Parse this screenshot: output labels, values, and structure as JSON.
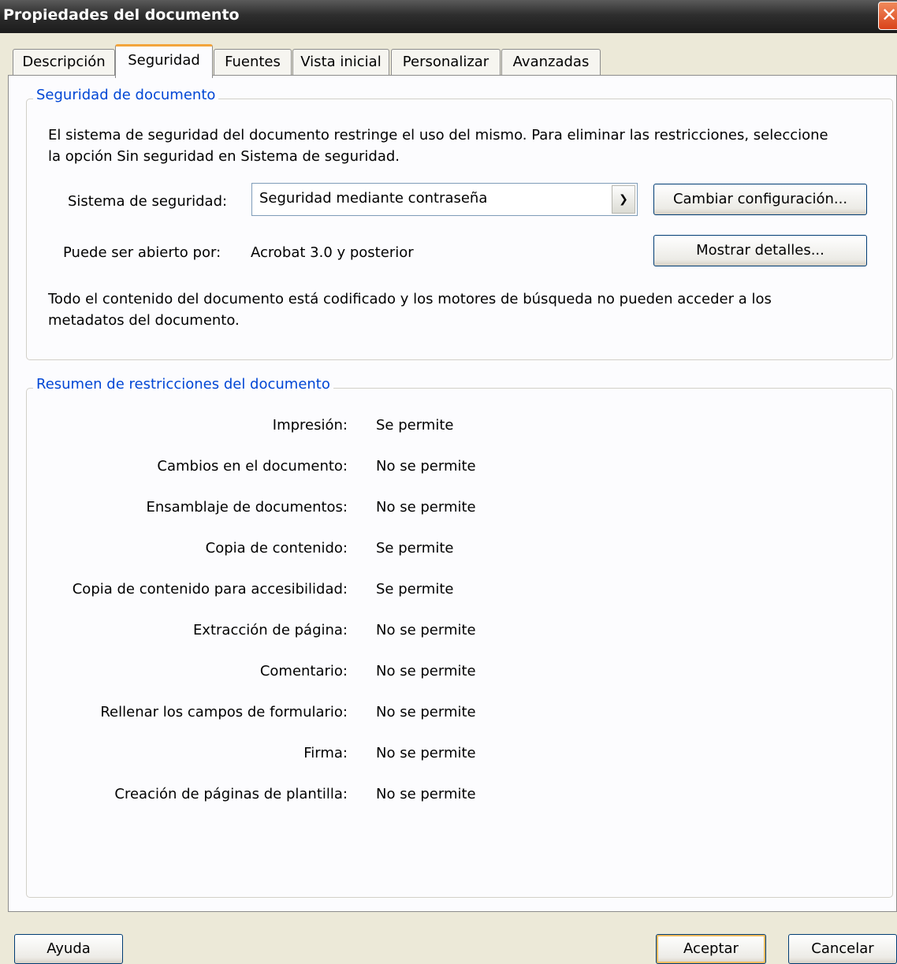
{
  "window": {
    "title": "Propiedades del documento",
    "close_glyph": "✕"
  },
  "tabs": [
    {
      "label": "Descripción"
    },
    {
      "label": "Seguridad",
      "active": true
    },
    {
      "label": "Fuentes"
    },
    {
      "label": "Vista inicial"
    },
    {
      "label": "Personalizar"
    },
    {
      "label": "Avanzadas"
    }
  ],
  "security_group": {
    "legend": "Seguridad de documento",
    "intro_line1": "El sistema de seguridad del documento restringe el uso del mismo. Para eliminar las restricciones, seleccione",
    "intro_line2": "la opción Sin seguridad en Sistema de seguridad.",
    "method_label": "Sistema de seguridad:",
    "method_value": "Seguridad mediante contraseña",
    "change_button": "Cambiar configuración...",
    "compat_label": "Puede ser abierto por:",
    "compat_value": "Acrobat 3.0 y posterior",
    "details_button": "Mostrar detalles...",
    "note_line1": "Todo el contenido del documento está codificado y los motores de búsqueda no pueden acceder a los",
    "note_line2": "metadatos del documento."
  },
  "restrictions_group": {
    "legend": "Resumen de restricciones del documento",
    "items": [
      {
        "label": "Impresión:",
        "value": "Se permite"
      },
      {
        "label": "Cambios en el documento:",
        "value": "No se permite"
      },
      {
        "label": "Ensamblaje de documentos:",
        "value": "No se permite"
      },
      {
        "label": "Copia de contenido:",
        "value": "Se permite"
      },
      {
        "label": "Copia de contenido para accesibilidad:",
        "value": "Se permite"
      },
      {
        "label": "Extracción de página:",
        "value": "No se permite"
      },
      {
        "label": "Comentario:",
        "value": "No se permite"
      },
      {
        "label": "Rellenar los campos de formulario:",
        "value": "No se permite"
      },
      {
        "label": "Firma:",
        "value": "No se permite"
      },
      {
        "label": "Creación de páginas de plantilla:",
        "value": "No se permite"
      }
    ],
    "graphic_icon": "stop-hand-icon",
    "graphic_colors": {
      "red": "#ff0000",
      "white": "#ffffff",
      "shadow": "#c8c8c8"
    }
  },
  "footer": {
    "help_button": "Ayuda",
    "ok_button": "Aceptar",
    "cancel_button": "Cancelar"
  }
}
